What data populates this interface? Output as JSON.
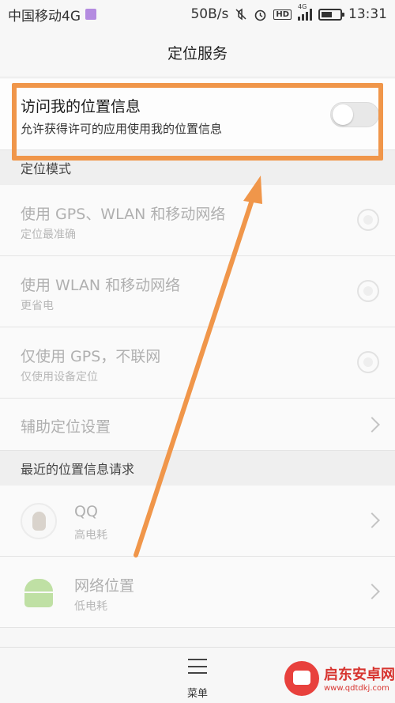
{
  "status_bar": {
    "carrier": "中国移动4G",
    "speed": "50B/s",
    "network_badge": "HD",
    "signal_label": "4G",
    "time": "13:31",
    "battery_level": 0.6,
    "icons": [
      "image-icon",
      "mute-icon",
      "alarm-icon",
      "hd-icon",
      "signal-icon",
      "battery-icon"
    ]
  },
  "title_bar": {
    "title": "定位服务"
  },
  "access_location": {
    "title": "访问我的位置信息",
    "subtitle": "允许获得许可的应用使用我的位置信息",
    "enabled": false
  },
  "location_mode": {
    "header": "定位模式",
    "options": [
      {
        "title": "使用 GPS、WLAN 和移动网络",
        "subtitle": "定位最准确"
      },
      {
        "title": "使用 WLAN 和移动网络",
        "subtitle": "更省电"
      },
      {
        "title": "仅使用 GPS，不联网",
        "subtitle": "仅使用设备定位"
      }
    ],
    "assist": {
      "title": "辅助定位设置"
    }
  },
  "recent_requests": {
    "header": "最近的位置信息请求",
    "apps": [
      {
        "name": "QQ",
        "usage": "高电耗",
        "icon": "qq-icon"
      },
      {
        "name": "网络位置",
        "usage": "低电耗",
        "icon": "android-icon"
      }
    ]
  },
  "bottom_bar": {
    "menu_label": "菜单"
  },
  "watermark": {
    "title": "启东安卓网",
    "url": "www.qdtdkj.com"
  },
  "colors": {
    "annotation": "#f0964a",
    "toggle_off": "#e8e8e8",
    "dim_text": "#b0b0b0",
    "section_bg": "#efefef"
  }
}
